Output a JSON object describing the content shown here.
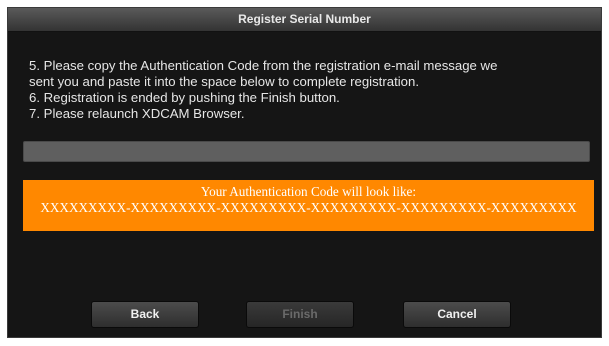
{
  "dialog": {
    "title": "Register Serial Number"
  },
  "instructions": {
    "line1": "5.  Please copy the Authentication Code from the registration e-mail message we",
    "line2": "sent you and paste it into the space below to complete registration.",
    "line3": "6.  Registration is ended by pushing the Finish button.",
    "line4": "7.  Please relaunch XDCAM Browser."
  },
  "code_input": {
    "value": "",
    "placeholder": ""
  },
  "code_hint": {
    "heading": "Your Authentication Code will look like:",
    "example": "XXXXXXXXX-XXXXXXXXX-XXXXXXXXX-XXXXXXXXX-XXXXXXXXX-XXXXXXXXX",
    "background_color": "#ff8800"
  },
  "buttons": {
    "back_label": "Back",
    "finish_label": "Finish",
    "finish_enabled": false,
    "cancel_label": "Cancel"
  }
}
